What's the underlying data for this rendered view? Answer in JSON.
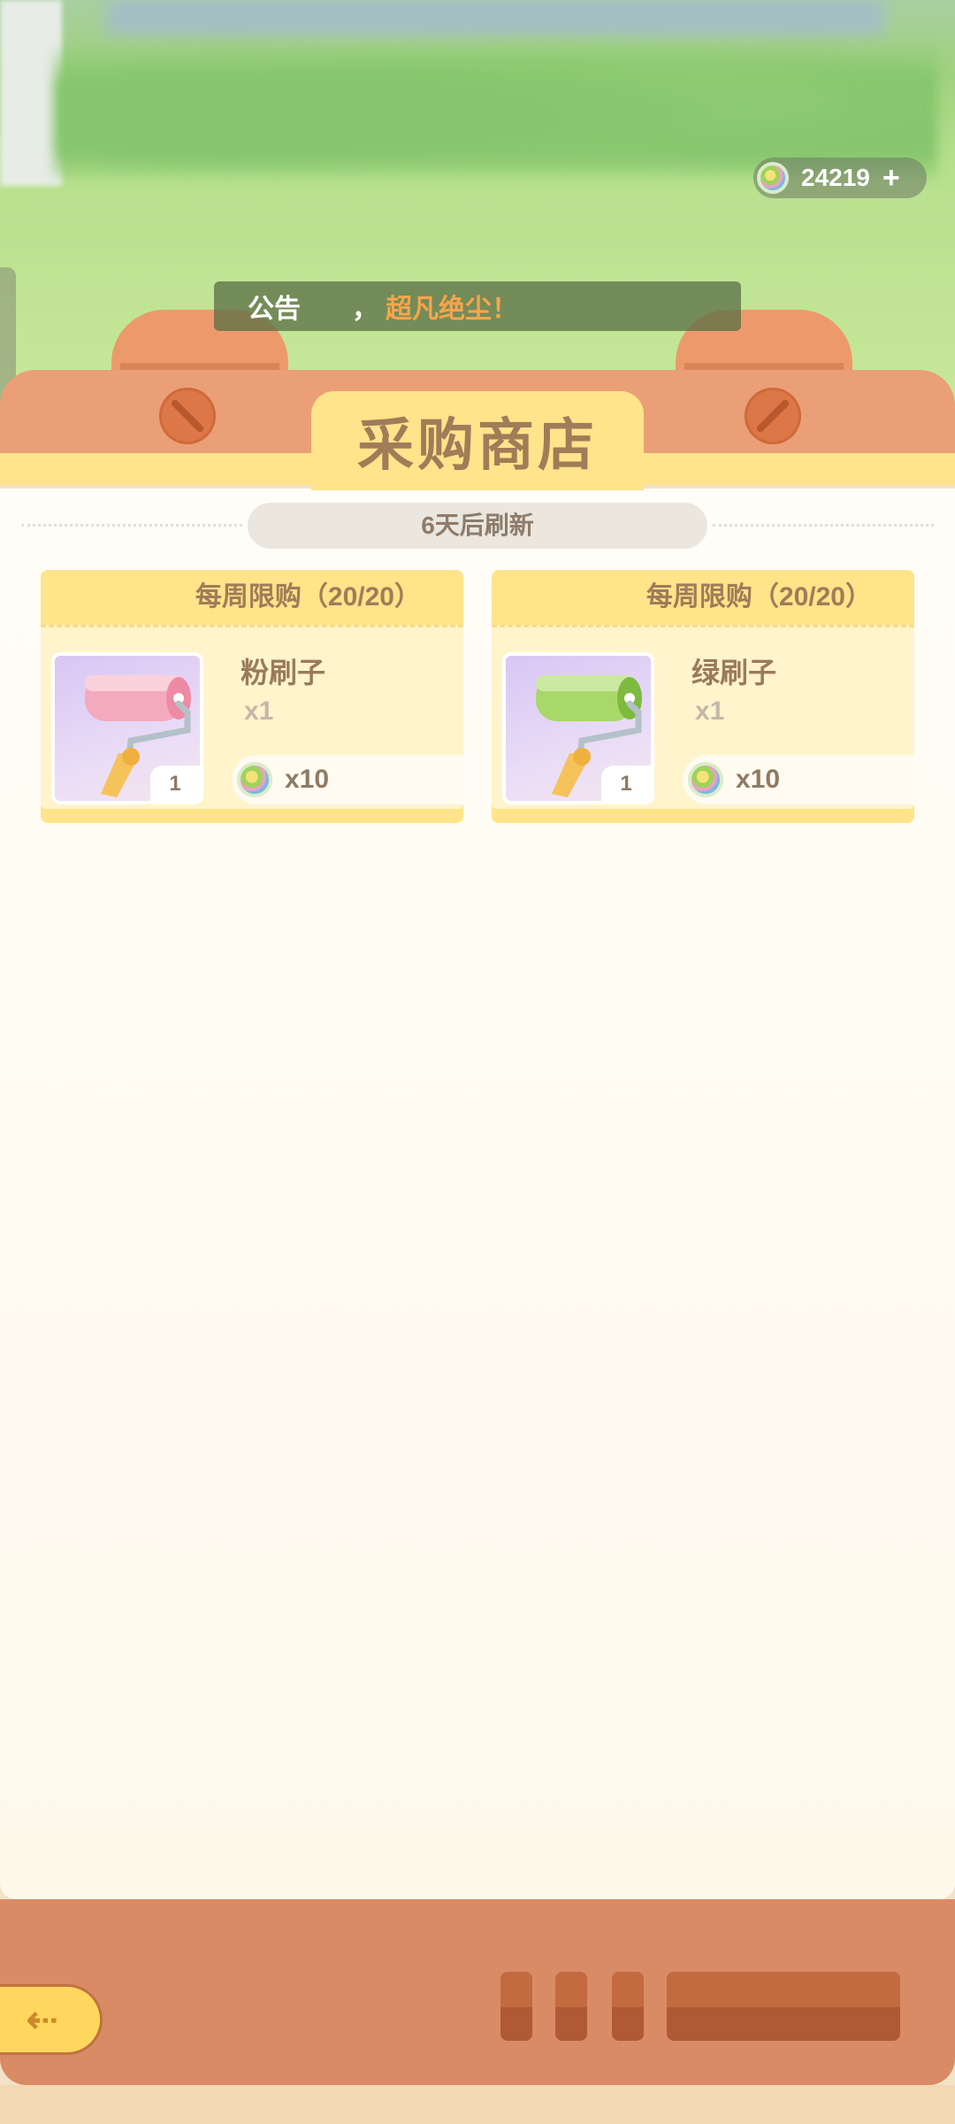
{
  "currency": {
    "amount": "24219",
    "add_label": "+",
    "icon": "rainbow-coin-icon"
  },
  "announcement": {
    "label": "公告",
    "separator": "，",
    "message": "超凡绝尘！"
  },
  "shop": {
    "title": "采购商店",
    "refresh_text": "6天后刷新",
    "items": [
      {
        "limit": "每周限购（20/20）",
        "name": "粉刷子",
        "count": "x1",
        "stock": "1",
        "price": "x10",
        "icon": "pink-paint-roller-icon",
        "color": "#f19fb4"
      },
      {
        "limit": "每周限购（20/20）",
        "name": "绿刷子",
        "count": "x1",
        "stock": "1",
        "price": "x10",
        "icon": "green-paint-roller-icon",
        "color": "#9ccf55"
      }
    ]
  },
  "nav": {
    "back_icon": "back-arrow-icon"
  },
  "colors": {
    "board": "#eb9f76",
    "accent": "#ffe48a",
    "text_brown": "#a27b58"
  }
}
